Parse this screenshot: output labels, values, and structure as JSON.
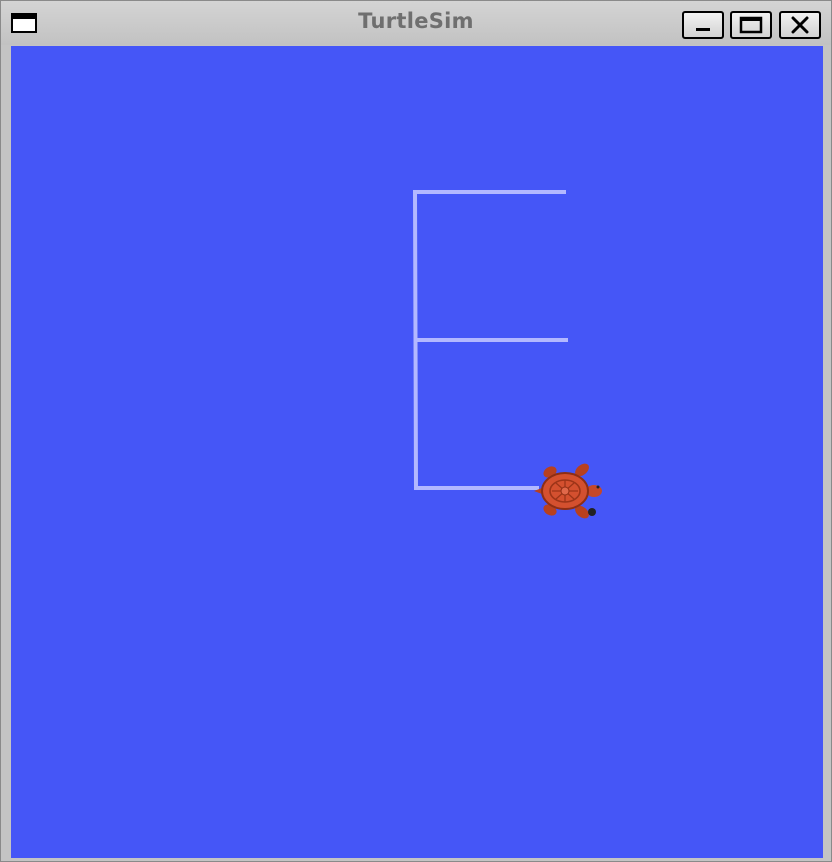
{
  "window": {
    "title": "TurtleSim",
    "buttons": {
      "minimize_icon": "minimize-icon",
      "maximize_icon": "maximize-icon",
      "close_icon": "close-icon"
    }
  },
  "canvas": {
    "background_color": "#4556f7",
    "pen_color": "#b3b8ff",
    "turtle_color": "#d4502f"
  }
}
